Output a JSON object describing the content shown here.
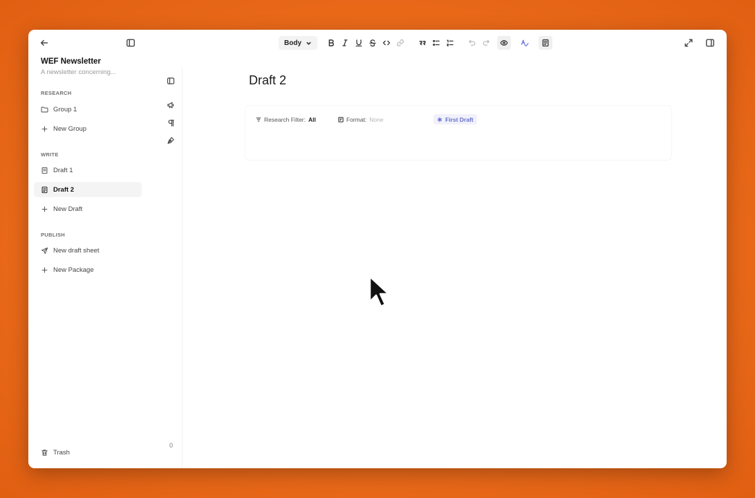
{
  "app": {
    "workspace_title": "WEF Newsletter",
    "workspace_subtitle": "A newsletter concerning..."
  },
  "toolbar": {
    "text_style": "Body",
    "icons": [
      "back-arrow-icon",
      "sidebar-toggle-icon",
      "bold-icon",
      "italic-icon",
      "underline-icon",
      "strikethrough-icon",
      "code-icon",
      "link-icon",
      "quote-icon",
      "bullet-list-icon",
      "numbered-list-icon",
      "undo-icon",
      "redo-icon",
      "preview-eye-icon",
      "spellcheck-icon",
      "document-icon",
      "expand-icon",
      "right-panel-icon"
    ]
  },
  "sidebar": {
    "sections": [
      {
        "heading": "RESEARCH",
        "items": [
          {
            "label": "Group 1",
            "icon": "folder-icon"
          },
          {
            "label": "New Group",
            "icon": "plus-icon"
          }
        ]
      },
      {
        "heading": "WRITE",
        "items": [
          {
            "label": "Draft 1",
            "icon": "document-icon"
          },
          {
            "label": "Draft 2",
            "icon": "document-icon",
            "selected": true
          },
          {
            "label": "New Draft",
            "icon": "plus-icon"
          }
        ]
      },
      {
        "heading": "PUBLISH",
        "items": [
          {
            "label": "New draft sheet",
            "icon": "send-icon"
          },
          {
            "label": "New Package",
            "icon": "plus-icon"
          }
        ]
      }
    ],
    "trash_label": "Trash"
  },
  "rail": {
    "count": "0"
  },
  "document": {
    "title": "Draft 2",
    "meta": {
      "research_filter_label": "Research Filter:",
      "research_filter_value": "All",
      "format_label": "Format:",
      "format_value": "None",
      "stage_tag": "First Draft"
    }
  },
  "colors": {
    "background": "#ea6a1a",
    "tag_text": "#6770c8",
    "tag_bg": "#f1f1fb"
  }
}
